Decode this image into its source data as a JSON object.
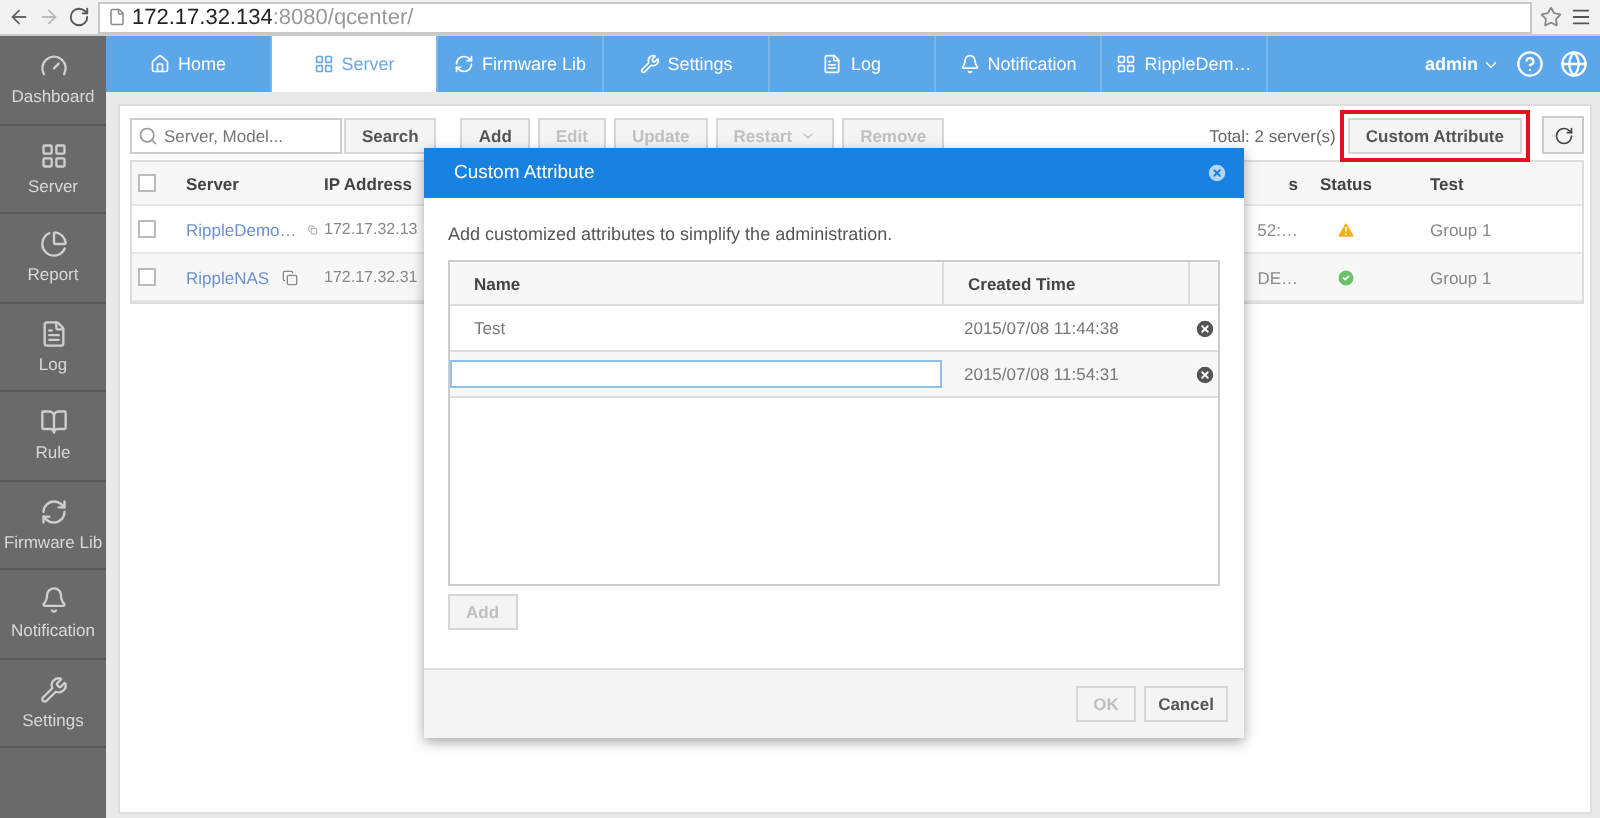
{
  "browser": {
    "url_host": "172.17.32.134",
    "url_path": ":8080/qcenter/"
  },
  "sidebar": {
    "items": [
      {
        "label": "Dashboard"
      },
      {
        "label": "Server"
      },
      {
        "label": "Report"
      },
      {
        "label": "Log"
      },
      {
        "label": "Rule"
      },
      {
        "label": "Firmware Lib"
      },
      {
        "label": "Notification"
      },
      {
        "label": "Settings"
      }
    ]
  },
  "nav": {
    "tabs": [
      {
        "label": "Home",
        "selected": false
      },
      {
        "label": "Server",
        "selected": true
      },
      {
        "label": "Firmware Lib",
        "selected": false
      },
      {
        "label": "Settings",
        "selected": false
      },
      {
        "label": "Log",
        "selected": false
      },
      {
        "label": "Notification",
        "selected": false
      },
      {
        "label": "RippleDem…",
        "selected": false
      }
    ],
    "user": "admin"
  },
  "toolbar": {
    "search": {
      "placeholder": "Server, Model..."
    },
    "search_button": "Search",
    "actions": [
      {
        "label": "Add",
        "disabled": false,
        "has_menu": false
      },
      {
        "label": "Edit",
        "disabled": true,
        "has_menu": false
      },
      {
        "label": "Update",
        "disabled": true,
        "has_menu": false
      },
      {
        "label": "Restart",
        "disabled": true,
        "has_menu": true
      },
      {
        "label": "Remove",
        "disabled": true,
        "has_menu": false
      }
    ],
    "total": "Total: 2 server(s)",
    "custom_attribute_button": {
      "label": "Custom Attribute",
      "highlighted": true
    }
  },
  "table": {
    "header_checked": false,
    "columns": [
      "Server",
      "IP Address",
      "s",
      "Status",
      "Test"
    ],
    "rows": [
      {
        "checked": false,
        "server": "RippleDemo…",
        "ip": "172.17.32.13",
        "column_4": "52:…",
        "status": {
          "kind": "warning"
        },
        "test": "Group 1"
      },
      {
        "checked": false,
        "server": "RippleNAS",
        "ip": "172.17.32.31",
        "column_4": "DE…",
        "status": {
          "kind": "ok"
        },
        "test": "Group 1"
      }
    ]
  },
  "modal": {
    "title": "Custom Attribute",
    "description": "Add customized attributes to simplify the administration.",
    "columns": [
      "Name",
      "Created Time"
    ],
    "rows": [
      {
        "kind": "text",
        "name": "Test",
        "created": "2015/07/08 11:44:38"
      },
      {
        "kind": "input",
        "name": "",
        "created": "2015/07/08 11:54:31"
      }
    ],
    "add_button": {
      "label": "Add",
      "disabled": true
    },
    "ok_button": {
      "label": "OK",
      "disabled": true
    },
    "cancel_button": {
      "label": "Cancel",
      "disabled": false
    }
  }
}
